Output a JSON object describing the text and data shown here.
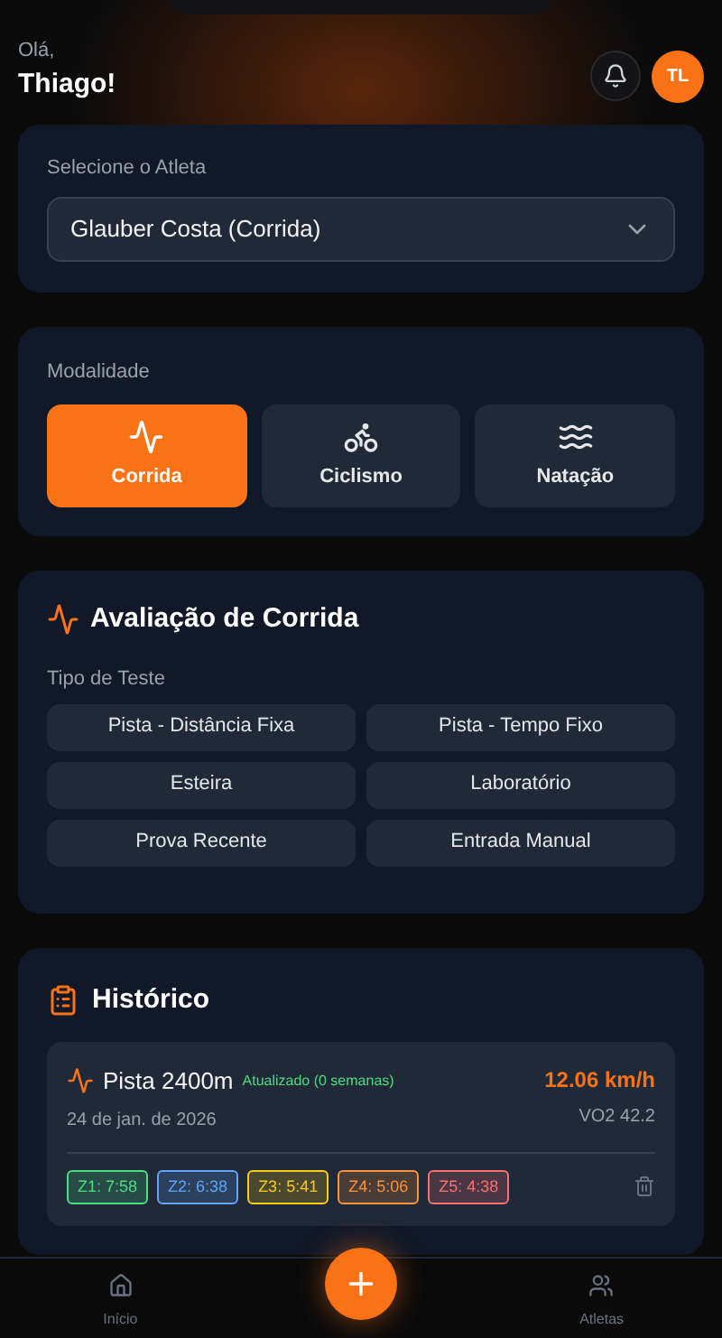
{
  "header": {
    "greeting": "Olá,",
    "name": "Thiago!",
    "avatar": "TL"
  },
  "athlete": {
    "label": "Selecione o Atleta",
    "value": "Glauber Costa (Corrida)"
  },
  "modality": {
    "label": "Modalidade",
    "options": [
      {
        "kind": "run",
        "label": "Corrida",
        "selected": true
      },
      {
        "kind": "bike",
        "label": "Ciclismo",
        "selected": false
      },
      {
        "kind": "swim",
        "label": "Natação",
        "selected": false
      }
    ]
  },
  "evaluation": {
    "title": "Avaliação de Corrida",
    "test_label": "Tipo de Teste",
    "tests": [
      "Pista - Distância Fixa",
      "Pista - Tempo Fixo",
      "Esteira",
      "Laboratório",
      "Prova Recente",
      "Entrada Manual"
    ]
  },
  "history": {
    "title": "Histórico",
    "entries": [
      {
        "name": "Pista 2400m",
        "status": "Atualizado (0 semanas)",
        "date": "24 de jan. de 2026",
        "speed": "12.06 km/h",
        "vo2": "VO2 42.2",
        "zones": [
          {
            "label": "Z1: 7:58",
            "color": "#4ade80"
          },
          {
            "label": "Z2: 6:38",
            "color": "#60a5fa"
          },
          {
            "label": "Z3: 5:41",
            "color": "#facc15"
          },
          {
            "label": "Z4: 5:06",
            "color": "#fb923c"
          },
          {
            "label": "Z5: 4:38",
            "color": "#f87171"
          }
        ]
      }
    ]
  },
  "nav": [
    {
      "kind": "home",
      "label": "Início",
      "selected": false
    },
    {
      "kind": "add",
      "selected": false
    },
    {
      "kind": "athletes",
      "label": "Atletas",
      "selected": false
    }
  ]
}
